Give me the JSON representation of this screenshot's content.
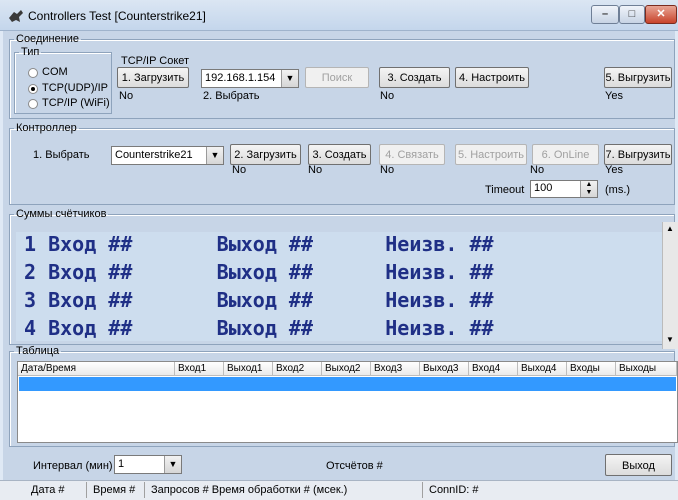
{
  "window": {
    "title": "Controllers Test [Counterstrike21]"
  },
  "connection": {
    "legend": "Соединение",
    "type_legend": "Тип",
    "types": [
      "COM",
      "TCP(UDP)/IP",
      "TCP/IP (WiFi)"
    ],
    "selected_type": "TCP(UDP)/IP",
    "socket_legend": "TCP/IP Сокет",
    "load_button": "1. Загрузить",
    "load_status": "No",
    "ip_value": "192.168.1.154",
    "choose_label": "2. Выбрать",
    "search_button": "Поиск",
    "create_button": "3. Создать",
    "create_status": "No",
    "configure_button": "4. Настроить",
    "unload_button": "5. Выгрузить",
    "unload_status": "Yes"
  },
  "controller": {
    "legend": "Контроллер",
    "choose_label": "1. Выбрать",
    "selected": "Counterstrike21",
    "load_button": "2. Загрузить",
    "load_status": "No",
    "create_button": "3. Создать",
    "create_status": "No",
    "link_button": "4. Связать",
    "link_status": "No",
    "configure_button": "5. Настроить",
    "online_button": "6. OnLine",
    "online_status": "No",
    "unload_button": "7. Выгрузить",
    "unload_status": "Yes",
    "timeout_label": "Timeout",
    "timeout_value": "100",
    "timeout_unit": "(ms.)"
  },
  "counters": {
    "legend": "Суммы счётчиков",
    "rows": [
      "1 Вход ##       Выход ##      Неизв. ##",
      "2 Вход ##       Выход ##      Неизв. ##",
      "3 Вход ##       Выход ##      Неизв. ##",
      "4 Вход ##       Выход ##      Неизв. ##"
    ]
  },
  "table": {
    "legend": "Таблица",
    "columns": [
      "Дата/Время",
      "Вход1",
      "Выход1",
      "Вход2",
      "Выход2",
      "Вход3",
      "Выход3",
      "Вход4",
      "Выход4",
      "Входы",
      "Выходы"
    ]
  },
  "bottom": {
    "interval_label": "Интервал (мин)",
    "interval_value": "1",
    "reports_label": "Отсчётов #",
    "exit_button": "Выход"
  },
  "statusbar": {
    "date": "Дата #",
    "time": "Время #",
    "requests": "Запросов # Время обработки # (мсек.)",
    "conn": "ConnID: #"
  },
  "colors": {
    "counter_text": "#1f2f86",
    "selection": "#3399ff"
  }
}
